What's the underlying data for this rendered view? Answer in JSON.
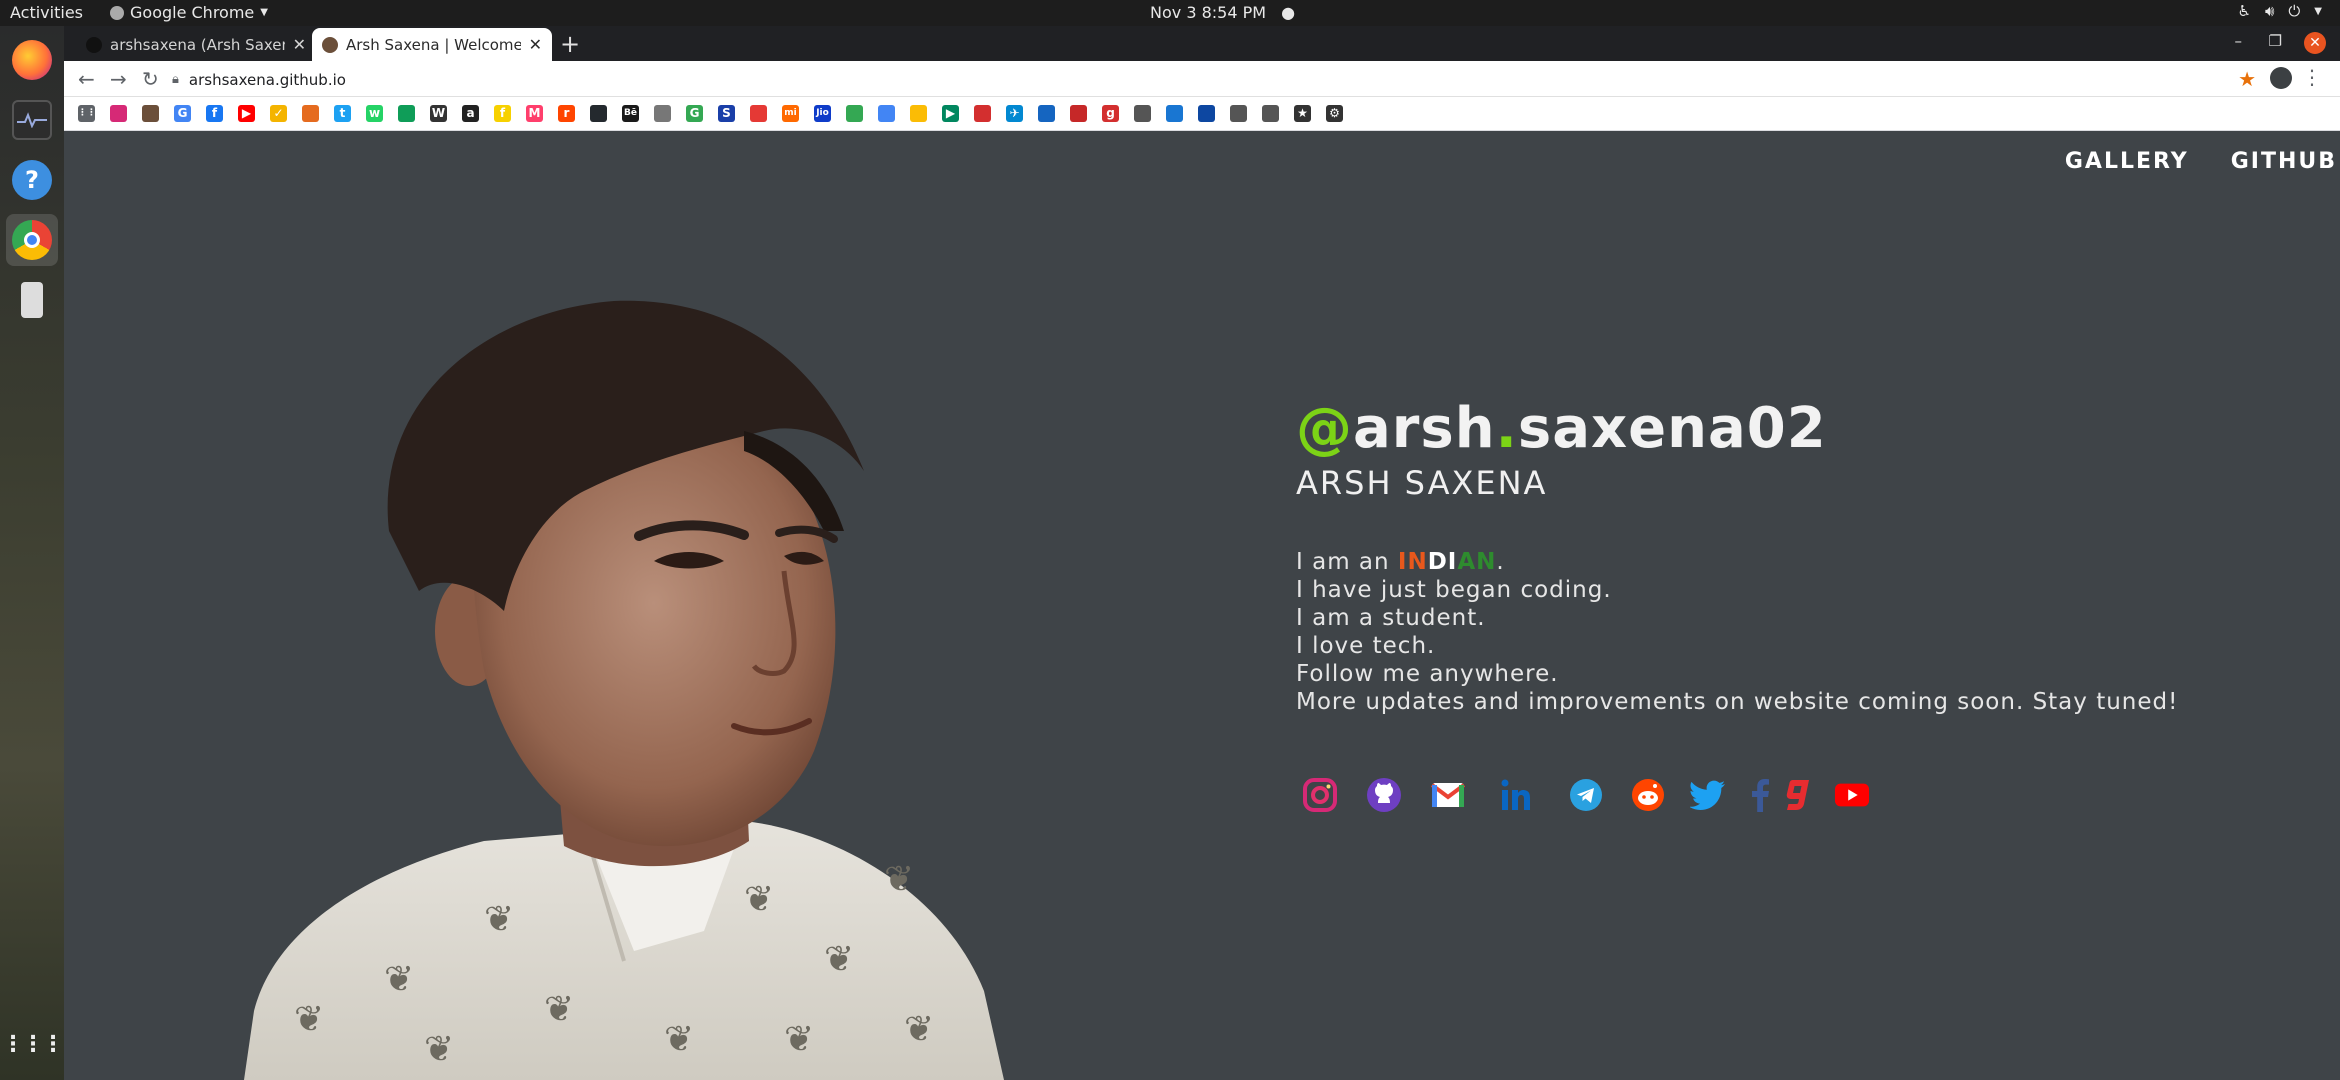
{
  "system": {
    "activities": "Activities",
    "app_name": "Google Chrome",
    "clock": "Nov 3   8:54 PM"
  },
  "browser": {
    "tabs": [
      {
        "title": "arshsaxena (Arsh Saxena)",
        "active": false
      },
      {
        "title": "Arsh Saxena | Welcome to",
        "active": true
      }
    ],
    "new_tab": "+",
    "url": "arshsaxena.github.io"
  },
  "bookmarks": [
    {
      "icon": "apps-icon",
      "glyph": "⋮⋮",
      "color": "#5f6368"
    },
    {
      "icon": "instagram-icon",
      "glyph": "",
      "color": "#d62976"
    },
    {
      "icon": "avatar-icon",
      "glyph": "",
      "color": "#6b4f3a"
    },
    {
      "icon": "google-icon",
      "glyph": "G",
      "color": "#4285f4"
    },
    {
      "icon": "facebook-icon",
      "glyph": "f",
      "color": "#1877f2"
    },
    {
      "icon": "youtube-icon",
      "glyph": "▶",
      "color": "#ff0000"
    },
    {
      "icon": "tick-icon",
      "glyph": "✓",
      "color": "#f4b400"
    },
    {
      "icon": "bookmark-icon",
      "glyph": "",
      "color": "#e56b1f"
    },
    {
      "icon": "twitter-icon",
      "glyph": "t",
      "color": "#1da1f2"
    },
    {
      "icon": "whatsapp-icon",
      "glyph": "w",
      "color": "#25d366"
    },
    {
      "icon": "sheets-icon",
      "glyph": "",
      "color": "#0f9d58"
    },
    {
      "icon": "wikipedia-icon",
      "glyph": "W",
      "color": "#333333"
    },
    {
      "icon": "amazon-icon",
      "glyph": "a",
      "color": "#222222"
    },
    {
      "icon": "flipkart-icon",
      "glyph": "f",
      "color": "#f7d100"
    },
    {
      "icon": "myntra-icon",
      "glyph": "M",
      "color": "#ff3f6c"
    },
    {
      "icon": "reddit-icon",
      "glyph": "r",
      "color": "#ff4500"
    },
    {
      "icon": "github-icon",
      "glyph": "",
      "color": "#24292e"
    },
    {
      "icon": "behance-icon",
      "glyph": "Bē",
      "color": "#1a1a1a"
    },
    {
      "icon": "apple-icon",
      "glyph": "",
      "color": "#777777"
    },
    {
      "icon": "google-icon",
      "glyph": "G",
      "color": "#34a853"
    },
    {
      "icon": "skype-icon",
      "glyph": "S",
      "color": "#1a3fa8"
    },
    {
      "icon": "calendar-icon",
      "glyph": "",
      "color": "#e53935"
    },
    {
      "icon": "mi-icon",
      "glyph": "mi",
      "color": "#ff6900"
    },
    {
      "icon": "jio-icon",
      "glyph": "Jio",
      "color": "#0f3cc9"
    },
    {
      "icon": "maps-icon",
      "glyph": "",
      "color": "#34a853"
    },
    {
      "icon": "translate-icon",
      "glyph": "",
      "color": "#4285f4"
    },
    {
      "icon": "photos-icon",
      "glyph": "",
      "color": "#fbbc05"
    },
    {
      "icon": "play-store-icon",
      "glyph": "▶",
      "color": "#01875f"
    },
    {
      "icon": "bookmark-icon",
      "glyph": "",
      "color": "#d32f2f"
    },
    {
      "icon": "flight-icon",
      "glyph": "✈",
      "color": "#0288d1"
    },
    {
      "icon": "bookmark-icon",
      "glyph": "",
      "color": "#1565c0"
    },
    {
      "icon": "bookmark-icon",
      "glyph": "",
      "color": "#c62828"
    },
    {
      "icon": "bookmark-icon",
      "glyph": "g",
      "color": "#d32f2f"
    },
    {
      "icon": "speed-icon",
      "glyph": "",
      "color": "#555555"
    },
    {
      "icon": "bookmark-icon",
      "glyph": "",
      "color": "#1976d2"
    },
    {
      "icon": "bookmark-icon",
      "glyph": "",
      "color": "#0d47a1"
    },
    {
      "icon": "history-icon",
      "glyph": "",
      "color": "#555555"
    },
    {
      "icon": "download-icon",
      "glyph": "",
      "color": "#555555"
    },
    {
      "icon": "star-icon",
      "glyph": "★",
      "color": "#333333"
    },
    {
      "icon": "settings-icon",
      "glyph": "⚙",
      "color": "#333333"
    }
  ],
  "site": {
    "nav": [
      "GALLERY",
      "GITHUB"
    ],
    "handle_at": "@",
    "handle_first": "arsh",
    "handle_dot": ".",
    "handle_last": "saxena02",
    "name": "ARSH SAXENA",
    "bio_prefix": "I am an ",
    "bio_indian_1": "IN",
    "bio_indian_2": "DI",
    "bio_indian_3": "AN",
    "bio_suffix": ".",
    "bio_lines": [
      "I have just began coding.",
      "I am a student.",
      "I love tech.",
      "Follow me anywhere.",
      "More updates and improvements on website coming soon. Stay tuned!"
    ],
    "socials": [
      {
        "name": "instagram-icon",
        "color": "#d62976"
      },
      {
        "name": "github-icon",
        "color": "#6e3fc2"
      },
      {
        "name": "gmail-icon",
        "color": "#ea4335"
      },
      {
        "name": "linkedin-icon",
        "color": "#0a66c2"
      },
      {
        "name": "telegram-icon",
        "color": "#2aa1e0"
      },
      {
        "name": "reddit-icon",
        "color": "#ff4500"
      },
      {
        "name": "twitter-icon",
        "color": "#1da1f2"
      },
      {
        "name": "facebook-icon",
        "color": "#3b5998"
      },
      {
        "name": "gaana-icon",
        "color": "#e72c30"
      },
      {
        "name": "youtube-icon",
        "color": "#ff0000"
      }
    ]
  },
  "colors": {
    "page_bg": "#3f4448",
    "accent_green": "#7cd316",
    "saffron": "#e8581c",
    "india_green": "#2e8b2e"
  }
}
